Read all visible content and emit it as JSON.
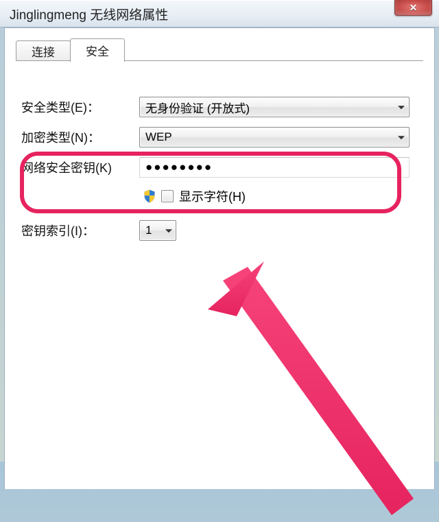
{
  "titlebar": {
    "text": "Jinglingmeng 无线网络属性",
    "close_glyph": "✕"
  },
  "tabs": {
    "connection": "连接",
    "security": "安全"
  },
  "fields": {
    "security_type": {
      "label": "安全类型(E)：",
      "value": "无身份验证 (开放式)"
    },
    "encryption_type": {
      "label": "加密类型(N)：",
      "value": "WEP"
    },
    "network_key": {
      "label": "网络安全密钥(K)",
      "value": "●●●●●●●●"
    },
    "show_chars": {
      "label": "显示字符(H)"
    },
    "key_index": {
      "label": "密钥索引(I)：",
      "value": "1"
    }
  }
}
